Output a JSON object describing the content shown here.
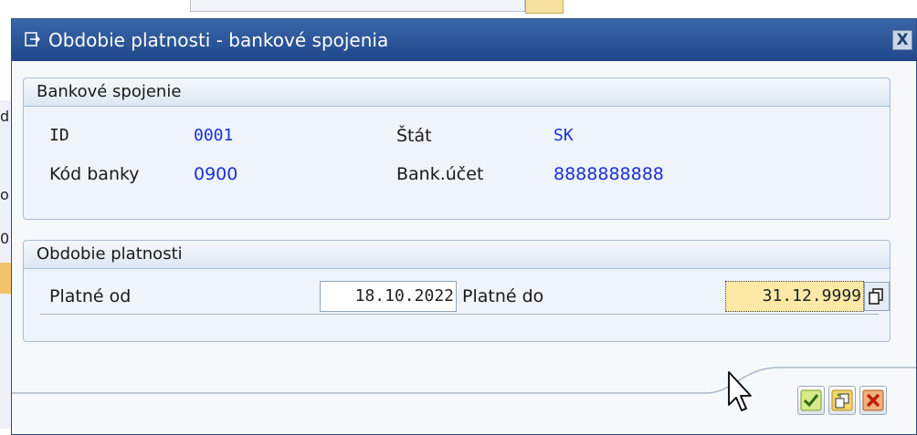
{
  "dialog": {
    "title": "Obdobie platnosti - bankové spojenia",
    "close_label": "X",
    "bank_group": {
      "title": "Bankové spojenie",
      "id_label": "ID",
      "id_value": "0001",
      "country_label": "Štát",
      "country_value": "SK",
      "bank_code_label": "Kód banky",
      "bank_code_value": "0900",
      "account_label": "Bank.účet",
      "account_value": "8888888888"
    },
    "validity_group": {
      "title": "Obdobie platnosti",
      "valid_from_label": "Platné od",
      "valid_from_value": "18.10.2022",
      "valid_to_label": "Platné do",
      "valid_to_value": "31.12.9999"
    },
    "buttons": {
      "confirm": "check-icon",
      "copy": "copy-icon",
      "cancel": "cancel-x-icon"
    }
  },
  "colors": {
    "titlebar": "#1f4789",
    "value_text": "#1d2fd6",
    "focused_field": "#fbe9a5"
  }
}
